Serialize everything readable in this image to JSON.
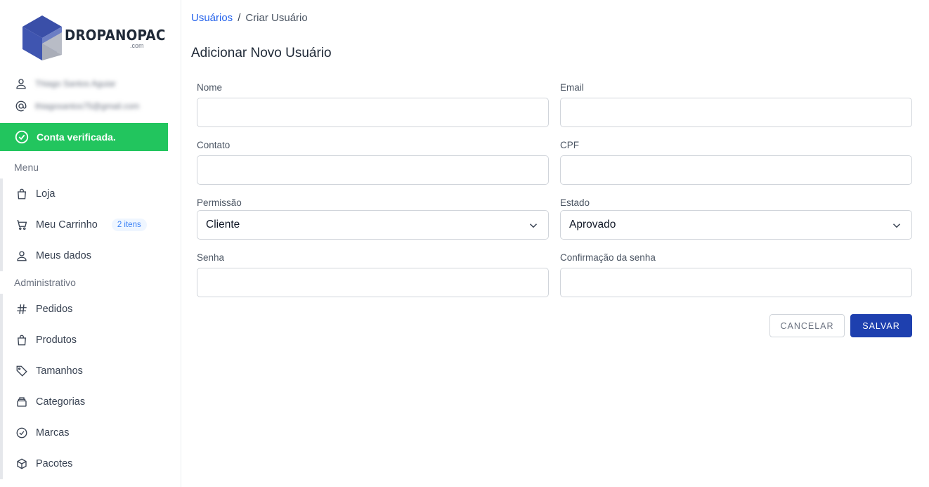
{
  "brand": {
    "name": "DROPANOPAC",
    "suffix": ".com",
    "colors": {
      "dark": "#3a4fa8",
      "light": "#6c7ec4",
      "gray": "#a9adb8"
    }
  },
  "user": {
    "name": "Thiago Santos Aguiar",
    "email": "thiagosantos75@gmail.com"
  },
  "verified_label": "Conta verificada.",
  "sidebar": {
    "menu_title": "Menu",
    "menu_items": [
      {
        "label": "Loja",
        "icon": "bag-icon"
      },
      {
        "label": "Meu Carrinho",
        "icon": "cart-icon",
        "badge": "2 itens"
      },
      {
        "label": "Meus dados",
        "icon": "user-icon"
      }
    ],
    "admin_title": "Administrativo",
    "admin_items": [
      {
        "label": "Pedidos",
        "icon": "hash-icon"
      },
      {
        "label": "Produtos",
        "icon": "bag-icon"
      },
      {
        "label": "Tamanhos",
        "icon": "tag-icon"
      },
      {
        "label": "Categorias",
        "icon": "archive-icon"
      },
      {
        "label": "Marcas",
        "icon": "check-circle-icon"
      },
      {
        "label": "Pacotes",
        "icon": "box-icon"
      }
    ]
  },
  "breadcrumb": {
    "parent": "Usuários",
    "separator": "/",
    "current": "Criar Usuário"
  },
  "page_title": "Adicionar Novo Usuário",
  "form": {
    "nome": {
      "label": "Nome",
      "value": ""
    },
    "email": {
      "label": "Email",
      "value": ""
    },
    "contato": {
      "label": "Contato",
      "value": ""
    },
    "cpf": {
      "label": "CPF",
      "value": ""
    },
    "permissao": {
      "label": "Permissão",
      "value": "Cliente"
    },
    "estado": {
      "label": "Estado",
      "value": "Aprovado"
    },
    "senha": {
      "label": "Senha",
      "value": ""
    },
    "confirmacao": {
      "label": "Confirmação da senha",
      "value": ""
    }
  },
  "actions": {
    "cancel": "CANCELAR",
    "save": "SALVAR"
  },
  "accent": {
    "primary": "#1e40af",
    "link": "#2563eb",
    "success": "#22c55e"
  }
}
